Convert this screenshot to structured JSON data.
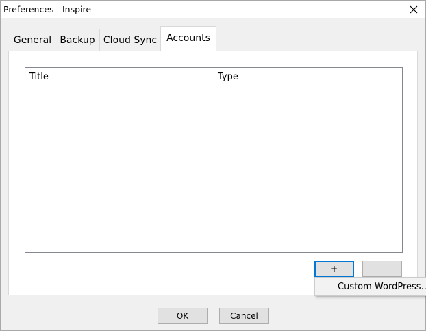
{
  "window": {
    "title": "Preferences - Inspire"
  },
  "tabs": [
    {
      "label": "General"
    },
    {
      "label": "Backup"
    },
    {
      "label": "Cloud Sync"
    },
    {
      "label": "Accounts",
      "active": true
    }
  ],
  "accounts_list": {
    "columns": [
      {
        "label": "Title"
      },
      {
        "label": "Type"
      }
    ],
    "rows": []
  },
  "list_buttons": {
    "add_label": "+",
    "remove_label": "-"
  },
  "add_menu": {
    "items": [
      {
        "label": "Custom WordPress..."
      }
    ]
  },
  "dialog_buttons": {
    "ok_label": "OK",
    "cancel_label": "Cancel"
  },
  "colors": {
    "focus_accent": "#0078d7",
    "window_bg": "#f0f0f0",
    "button_bg": "#e1e1e1"
  },
  "icons": {
    "close": "close-icon"
  }
}
